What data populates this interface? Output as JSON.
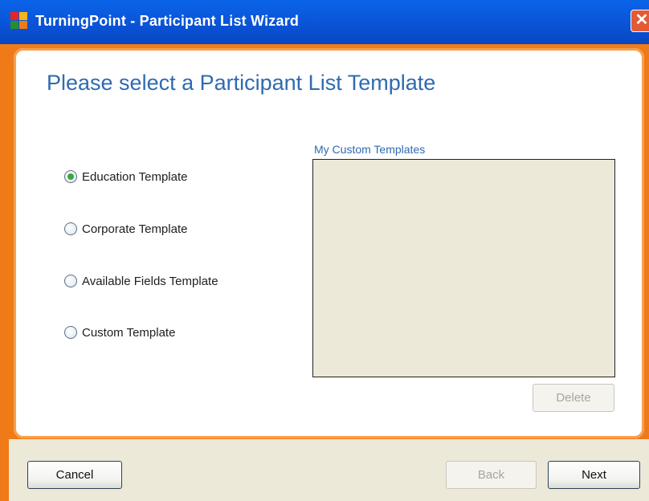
{
  "window": {
    "title": "TurningPoint - Participant List Wizard"
  },
  "header": {
    "heading": "Please select a Participant List Template"
  },
  "templates": [
    {
      "label": "Education Template",
      "selected": true
    },
    {
      "label": "Corporate Template",
      "selected": false
    },
    {
      "label": "Available Fields Template",
      "selected": false
    },
    {
      "label": "Custom Template",
      "selected": false
    }
  ],
  "custom": {
    "label": "My Custom Templates",
    "delete_label": "Delete"
  },
  "footer": {
    "cancel_label": "Cancel",
    "back_label": "Back",
    "next_label": "Next"
  },
  "colors": {
    "title_bar": "#0a52d6",
    "frame_accent": "#f07a18",
    "heading": "#2f6ab0",
    "list_bg": "#ece9d8"
  },
  "icons": {
    "app": "turningpoint-logo-icon",
    "close": "close-icon"
  }
}
